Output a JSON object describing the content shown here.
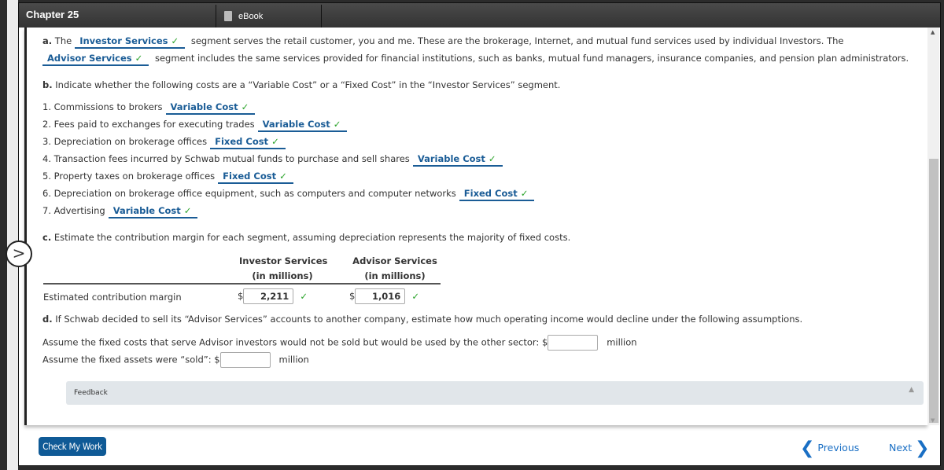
{
  "header": {
    "chapter": "Chapter 25",
    "ebook_tab": "eBook"
  },
  "part_a": {
    "label": "a.",
    "pre": "The",
    "ans1": "Investor Services",
    "mid1": "segment serves the retail customer, you and me. These are the brokerage, Internet, and mutual fund services used by individual Investors. The",
    "ans2": "Advisor Services",
    "mid2": "segment includes the same services provided for financial institutions, such as banks, mutual fund managers, insurance companies, and pension plan administrators."
  },
  "part_b": {
    "label": "b.",
    "text": "Indicate whether the following costs are a “Variable Cost” or a “Fixed Cost” in the “Investor Services” segment.",
    "items": [
      {
        "text": "1. Commissions to brokers",
        "answer": "Variable Cost"
      },
      {
        "text": "2. Fees paid to exchanges for executing trades",
        "answer": "Variable Cost"
      },
      {
        "text": "3. Depreciation on brokerage offices",
        "answer": "Fixed Cost"
      },
      {
        "text": "4. Transaction fees incurred by Schwab mutual funds to purchase and sell shares",
        "answer": "Variable Cost"
      },
      {
        "text": "5. Property taxes on brokerage offices",
        "answer": "Fixed Cost"
      },
      {
        "text": "6. Depreciation on brokerage office equipment, such as computers and computer networks",
        "answer": "Fixed Cost"
      },
      {
        "text": "7. Advertising",
        "answer": "Variable Cost"
      }
    ]
  },
  "part_c": {
    "label": "c.",
    "text": "Estimate the contribution margin for each segment, assuming depreciation represents the majority of fixed costs.",
    "col1": "Investor Services",
    "col2": "Advisor Services",
    "unit": "(in millions)",
    "row_label": "Estimated contribution margin",
    "currency": "$",
    "val1": "2,211",
    "val2": "1,016"
  },
  "part_d": {
    "label": "d.",
    "text": "If Schwab decided to sell its “Advisor Services” accounts to another company, estimate how much operating income would decline under the following assumptions.",
    "q1": "Assume the fixed costs that serve Advisor investors would not be sold but would be used by the other sector: $",
    "q2": "Assume the fixed assets were “sold”: $",
    "unit": "million",
    "a1": "",
    "a2": ""
  },
  "check": "✓",
  "feedback": "Feedback",
  "footer": {
    "check_button": "Check My Work",
    "previous": "Previous",
    "next": "Next"
  }
}
